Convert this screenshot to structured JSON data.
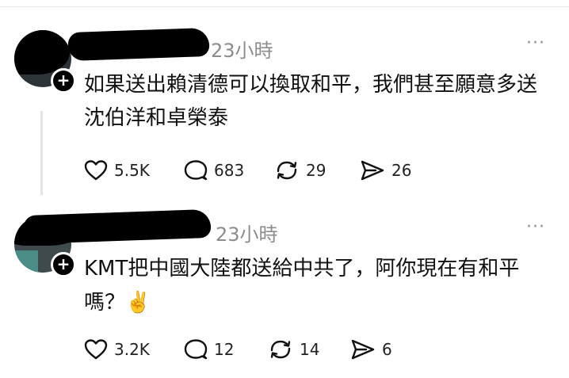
{
  "posts": [
    {
      "timestamp": "23小時",
      "body_line1": "如果送出賴清德可以換取和平，我們甚至願意多送",
      "body_line2": "沈伯洋和卓榮泰",
      "likes": "5.5K",
      "replies": "683",
      "reposts": "29",
      "shares": "26"
    },
    {
      "timestamp": "23小時",
      "body_line1": "KMT把中國大陸都送給中共了，阿你現在有和平",
      "body_line2": "嗎？✌️",
      "likes": "3.2K",
      "replies": "12",
      "reposts": "14",
      "shares": "6"
    }
  ],
  "more_menu": "···",
  "follow_badge": "+",
  "icons": {
    "like": "heart-icon",
    "reply": "comment-bubble-icon",
    "repost": "repost-arrows-icon",
    "share": "send-icon",
    "follow": "plus-icon",
    "menu": "more-dots-icon"
  }
}
